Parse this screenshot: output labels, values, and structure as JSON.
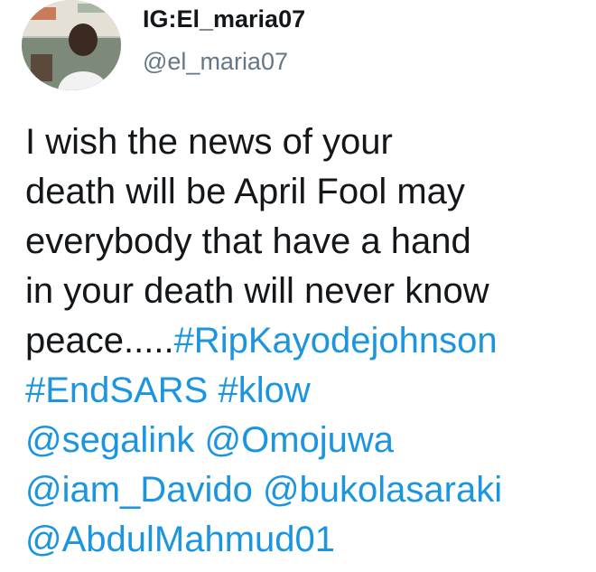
{
  "author": {
    "display_name": "IG:El_maria07",
    "handle": "@el_maria07",
    "avatar_icon": "profile-photo"
  },
  "tweet": {
    "line1": "I wish the news of your",
    "line2": "death will be April Fool may",
    "line3": "everybody that have a hand",
    "line4": "in your death will never know",
    "line5_text": "peace.....",
    "hashtags": [
      "#RipKayodejohnson",
      "#EndSARS",
      "#klow"
    ],
    "mentions": [
      "@segalink",
      "@Omojuwa",
      "@iam_Davido",
      "@bukolasaraki",
      "@AbdulMahmud01"
    ]
  },
  "colors": {
    "link": "#1b95e0",
    "text": "#14171a",
    "secondary": "#657786"
  }
}
